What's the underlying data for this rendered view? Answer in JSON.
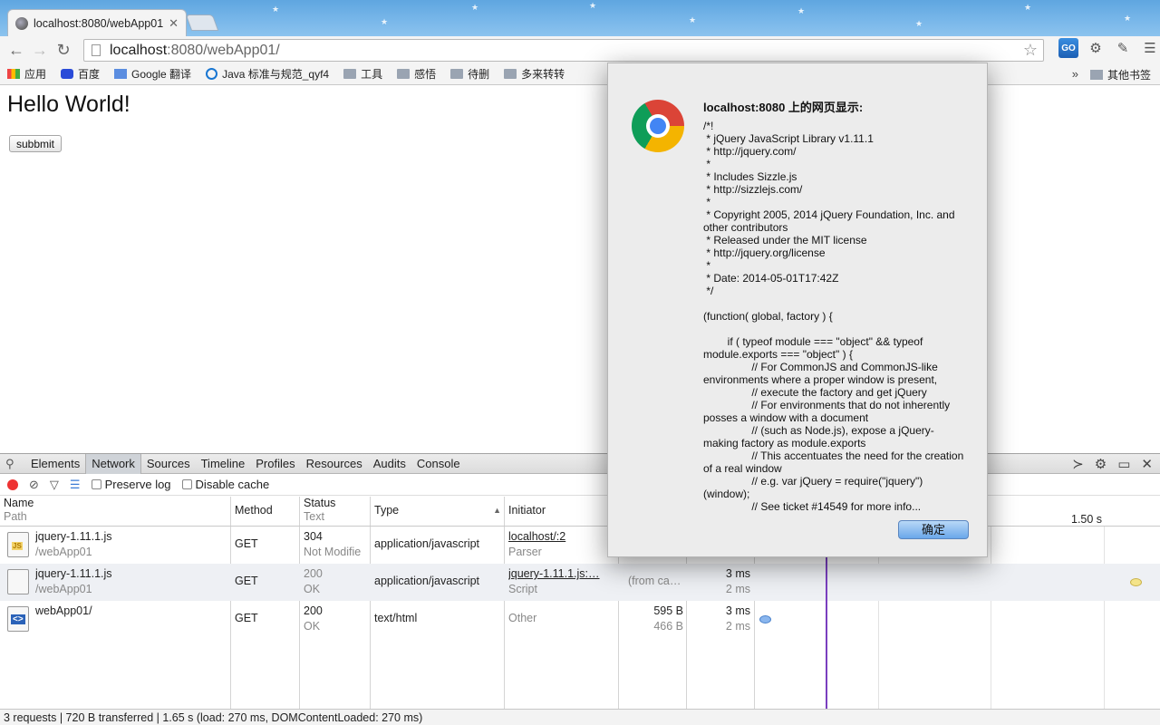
{
  "browser": {
    "tab_title": "localhost:8080/webApp01/",
    "url_host": "localhost",
    "url_rest": ":8080/webApp01/",
    "bookmarks": [
      {
        "label": "应用",
        "icon": "apps-grid-icon"
      },
      {
        "label": "百度",
        "icon": "baidu-paw-icon"
      },
      {
        "label": "Google 翻译",
        "icon": "translate-icon"
      },
      {
        "label": "Java 标准与规范_qyf4",
        "icon": "java-site-icon"
      },
      {
        "label": "工具",
        "icon": "folder-icon"
      },
      {
        "label": "感悟",
        "icon": "folder-icon"
      },
      {
        "label": "待删",
        "icon": "folder-icon"
      },
      {
        "label": "多来转转",
        "icon": "folder-icon"
      }
    ],
    "bookmarks_more": "»",
    "other_bookmarks": "其他书签"
  },
  "page": {
    "heading": "Hello World!",
    "submit_label": "subbmit"
  },
  "devtools": {
    "tabs": [
      "Elements",
      "Network",
      "Sources",
      "Timeline",
      "Profiles",
      "Resources",
      "Audits",
      "Console"
    ],
    "active_tab": "Network",
    "preserve_log": "Preserve log",
    "disable_cache": "Disable cache",
    "headers": {
      "name": "Name",
      "name_sub": "Path",
      "method": "Method",
      "status": "Status",
      "status_sub": "Text",
      "type": "Type",
      "initiator": "Initiator",
      "timeline_tick": "1.50 s"
    },
    "rows": [
      {
        "name": "jquery-1.11.1.js",
        "path": "/webApp01",
        "method": "GET",
        "status": "304",
        "status_text": "Not Modifie",
        "type": "application/javascript",
        "initiator": "localhost/:2",
        "initiator_sub": "Parser",
        "size": "",
        "size_sub": "",
        "time": "",
        "time_sub": ""
      },
      {
        "name": "jquery-1.11.1.js",
        "path": "/webApp01",
        "method": "GET",
        "status": "200",
        "status_text": "OK",
        "type": "application/javascript",
        "initiator": "jquery-1.11.1.js:…",
        "initiator_sub": "Script",
        "size": "(from ca…",
        "size_sub": "",
        "time": "3 ms",
        "time_sub": "2 ms"
      },
      {
        "name": "webApp01/",
        "path": "",
        "method": "GET",
        "status": "200",
        "status_text": "OK",
        "type": "text/html",
        "initiator": "Other",
        "initiator_sub": "",
        "size": "595 B",
        "size_sub": "466 B",
        "time": "3 ms",
        "time_sub": "2 ms"
      }
    ],
    "status_summary": "3 requests | 720 B transferred | 1.65 s (load: 270 ms, DOMContentLoaded: 270 ms)"
  },
  "dialog": {
    "title": "localhost:8080 上的网页显示:",
    "message": "/*!\n * jQuery JavaScript Library v1.11.1\n * http://jquery.com/\n *\n * Includes Sizzle.js\n * http://sizzlejs.com/\n *\n * Copyright 2005, 2014 jQuery Foundation, Inc. and other contributors\n * Released under the MIT license\n * http://jquery.org/license\n *\n * Date: 2014-05-01T17:42Z\n */\n\n(function( global, factory ) {\n\n\tif ( typeof module === \"object\" && typeof module.exports === \"object\" ) {\n\t\t// For CommonJS and CommonJS-like environments where a proper window is present,\n\t\t// execute the factory and get jQuery\n\t\t// For environments that do not inherently posses a window with a document\n\t\t// (such as Node.js), expose a jQuery-making factory as module.exports\n\t\t// This accentuates the need for the creation of a real window\n\t\t// e.g. var jQuery = require(\"jquery\")(window);\n\t\t// See ticket #14549 for more info...",
    "ok_label": "确定"
  }
}
